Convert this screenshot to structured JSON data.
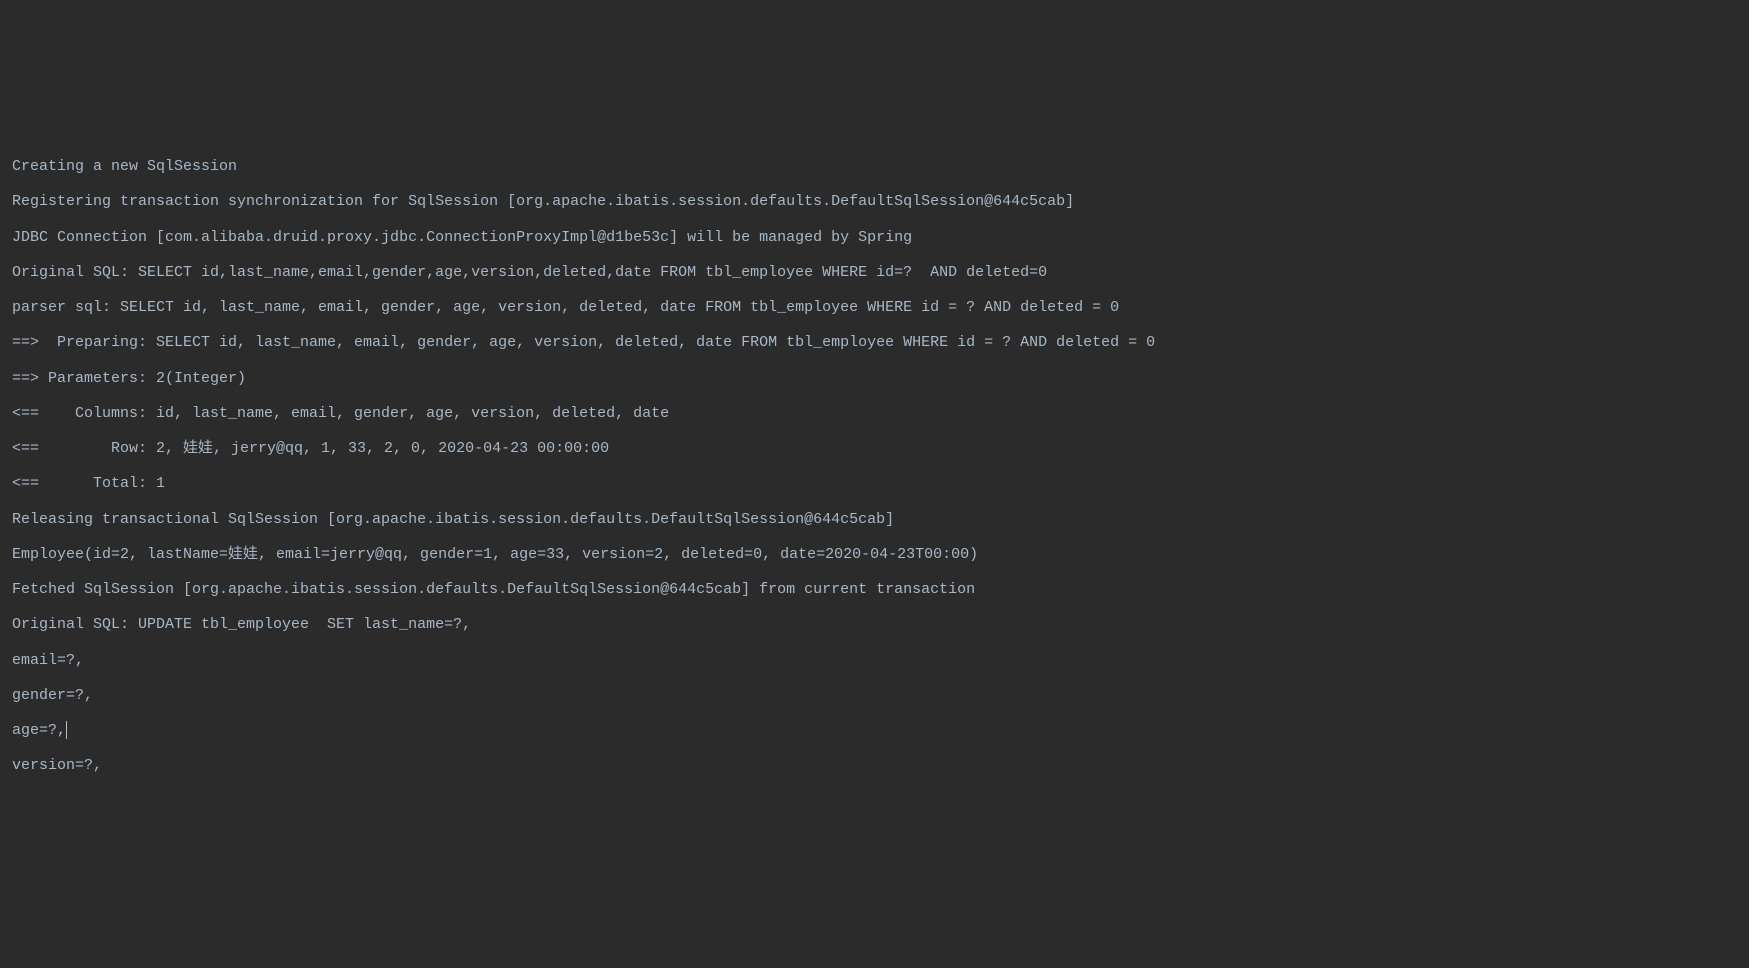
{
  "log": {
    "lines": [
      "Creating a new SqlSession",
      "Registering transaction synchronization for SqlSession [org.apache.ibatis.session.defaults.DefaultSqlSession@644c5cab]",
      "JDBC Connection [com.alibaba.druid.proxy.jdbc.ConnectionProxyImpl@d1be53c] will be managed by Spring",
      "Original SQL: SELECT id,last_name,email,gender,age,version,deleted,date FROM tbl_employee WHERE id=?  AND deleted=0",
      "parser sql: SELECT id, last_name, email, gender, age, version, deleted, date FROM tbl_employee WHERE id = ? AND deleted = 0",
      "==>  Preparing: SELECT id, last_name, email, gender, age, version, deleted, date FROM tbl_employee WHERE id = ? AND deleted = 0 ",
      "==> Parameters: 2(Integer)",
      "<==    Columns: id, last_name, email, gender, age, version, deleted, date",
      "<==        Row: 2, 娃娃, jerry@qq, 1, 33, 2, 0, 2020-04-23 00:00:00",
      "<==      Total: 1",
      "Releasing transactional SqlSession [org.apache.ibatis.session.defaults.DefaultSqlSession@644c5cab]",
      "Employee(id=2, lastName=娃娃, email=jerry@qq, gender=1, age=33, version=2, deleted=0, date=2020-04-23T00:00)",
      "Fetched SqlSession [org.apache.ibatis.session.defaults.DefaultSqlSession@644c5cab] from current transaction",
      "Original SQL: UPDATE tbl_employee  SET last_name=?,",
      "email=?,",
      "gender=?,",
      "age=?,",
      "version=?,"
    ],
    "cursorLine": 16
  }
}
